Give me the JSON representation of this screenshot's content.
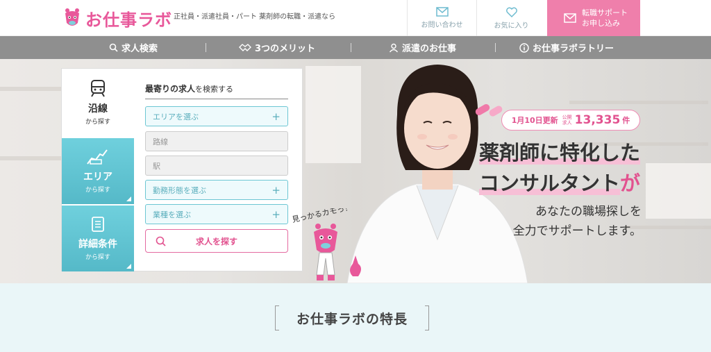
{
  "header": {
    "logo_text": "お仕事ラボ",
    "tagline": "正社員・派遣社員・パート 薬剤師の転職・派遣なら",
    "contact_label": "お問い合わせ",
    "favorites_label": "お気に入り",
    "cta_line1": "転職サポート",
    "cta_line2": "お申し込み"
  },
  "nav": {
    "items": [
      {
        "label": "求人検索",
        "icon": "search-icon"
      },
      {
        "label": "3つのメリット",
        "icon": "handshake-icon"
      },
      {
        "label": "派遣のお仕事",
        "icon": "person-icon"
      },
      {
        "label": "お仕事ラボラトリー",
        "icon": "info-icon"
      }
    ]
  },
  "search": {
    "tabs": [
      {
        "label": "沿線",
        "sub": "から探す",
        "icon": "train-icon"
      },
      {
        "label": "エリア",
        "sub": "から探す",
        "icon": "map-icon"
      },
      {
        "label": "詳細条件",
        "sub": "から探す",
        "icon": "checklist-icon"
      }
    ],
    "title_bold": "最寄りの求人",
    "title_rest": "を検索する",
    "area_select": "エリアを選ぶ",
    "line_placeholder": "路線",
    "station_placeholder": "駅",
    "employment_select": "勤務形態を選ぶ",
    "industry_select": "業種を選ぶ",
    "submit_label": "求人を探す"
  },
  "hero": {
    "update_label": "1月10日更新",
    "public_label_1": "公開",
    "public_label_2": "求人",
    "job_count": "13,335",
    "job_unit": "件",
    "headline_1": "薬剤師に特化した",
    "headline_2": "コンサルタント",
    "headline_2_suffix": "が",
    "sub_1": "あなたの職場探しを",
    "sub_2": "全力でサポートします。",
    "mascot_speech": "見っかるカモっ！"
  },
  "features": {
    "title": "お仕事ラボの特長"
  },
  "colors": {
    "brand_pink": "#e2528f",
    "accent_teal": "#55b9c8",
    "nav_gray": "#8f8f8f"
  }
}
